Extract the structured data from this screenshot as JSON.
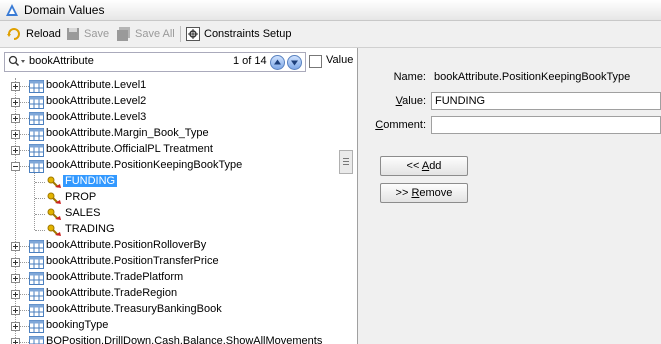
{
  "window": {
    "title": "Domain Values"
  },
  "toolbar": {
    "reload": "Reload",
    "save": "Save",
    "save_all": "Save All",
    "constraints": "Constraints Setup"
  },
  "search": {
    "value": "bookAttribute",
    "count": "1 of 14",
    "value_checkbox_label": "Value",
    "value_checked": false
  },
  "tree": {
    "items": [
      {
        "label": "bookAttribute.Level1",
        "type": "domain",
        "expanded": false,
        "selected": false
      },
      {
        "label": "bookAttribute.Level2",
        "type": "domain",
        "expanded": false,
        "selected": false
      },
      {
        "label": "bookAttribute.Level3",
        "type": "domain",
        "expanded": false,
        "selected": false
      },
      {
        "label": "bookAttribute.Margin_Book_Type",
        "type": "domain",
        "expanded": false,
        "selected": false
      },
      {
        "label": "bookAttribute.OfficialPL Treatment",
        "type": "domain",
        "expanded": false,
        "selected": false
      },
      {
        "label": "bookAttribute.PositionKeepingBookType",
        "type": "domain",
        "expanded": true,
        "selected": false
      },
      {
        "label": "FUNDING",
        "type": "value",
        "selected": true
      },
      {
        "label": "PROP",
        "type": "value",
        "selected": false
      },
      {
        "label": "SALES",
        "type": "value",
        "selected": false
      },
      {
        "label": "TRADING",
        "type": "value",
        "selected": false
      },
      {
        "label": "bookAttribute.PositionRolloverBy",
        "type": "domain",
        "expanded": false,
        "selected": false
      },
      {
        "label": "bookAttribute.PositionTransferPrice",
        "type": "domain",
        "expanded": false,
        "selected": false
      },
      {
        "label": "bookAttribute.TradePlatform",
        "type": "domain",
        "expanded": false,
        "selected": false
      },
      {
        "label": "bookAttribute.TradeRegion",
        "type": "domain",
        "expanded": false,
        "selected": false
      },
      {
        "label": "bookAttribute.TreasuryBankingBook",
        "type": "domain",
        "expanded": false,
        "selected": false
      },
      {
        "label": "bookingType",
        "type": "domain",
        "expanded": false,
        "selected": false
      },
      {
        "label": "BOPosition.DrillDown.Cash.Balance.ShowAllMovements",
        "type": "domain",
        "expanded": false,
        "selected": false
      }
    ]
  },
  "details": {
    "name_label": "Name:",
    "name_value": "bookAttribute.PositionKeepingBookType",
    "value_label": "Value:",
    "value_value": "FUNDING",
    "comment_label": "Comment:",
    "comment_value": "",
    "add_button": "<< Add",
    "remove_button": ">> Remove"
  },
  "colors": {
    "selection": "#3399ff",
    "accent": "#2f6fbd"
  }
}
